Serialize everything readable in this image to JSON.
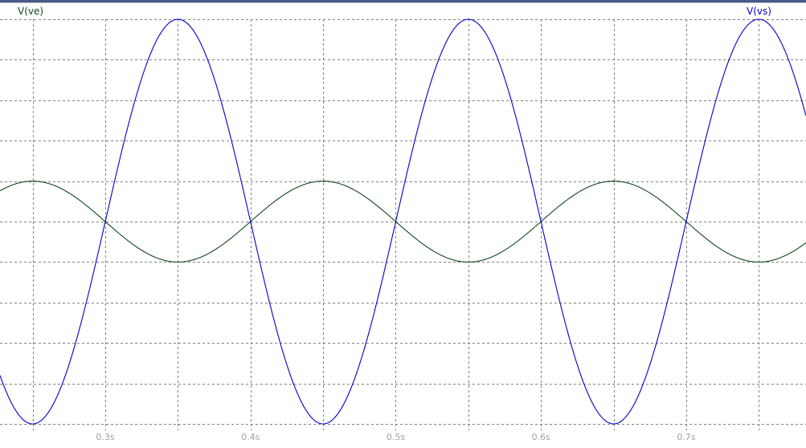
{
  "chart_data": {
    "type": "line",
    "title": "",
    "xlabel": "",
    "ylabel": "",
    "xlim": [
      0.2275,
      0.7825
    ],
    "ylim": [
      -1.0,
      1.0
    ],
    "grid": true,
    "x_ticks": [
      0.3,
      0.4,
      0.5,
      0.6,
      0.7
    ],
    "x_tick_labels": [
      "0.3s",
      "0.4s",
      "0.5s",
      "0.6s",
      "0.7s"
    ],
    "series": [
      {
        "name": "V(ve)",
        "color": "#0b4a1a",
        "label_position": "top-left",
        "amplitude": 0.2,
        "frequency_hz": 5,
        "phase_rad": 0,
        "function": "sine"
      },
      {
        "name": "V(vs)",
        "color": "#0000cc",
        "label_position": "top-right",
        "amplitude": 1.0,
        "frequency_hz": 5,
        "phase_rad": 3.14159,
        "function": "sine"
      }
    ]
  },
  "colors": {
    "background": "#ffffff",
    "grid": "#808080",
    "tick_text": "#a0a0a0",
    "top_border": "#4a5a8a"
  }
}
